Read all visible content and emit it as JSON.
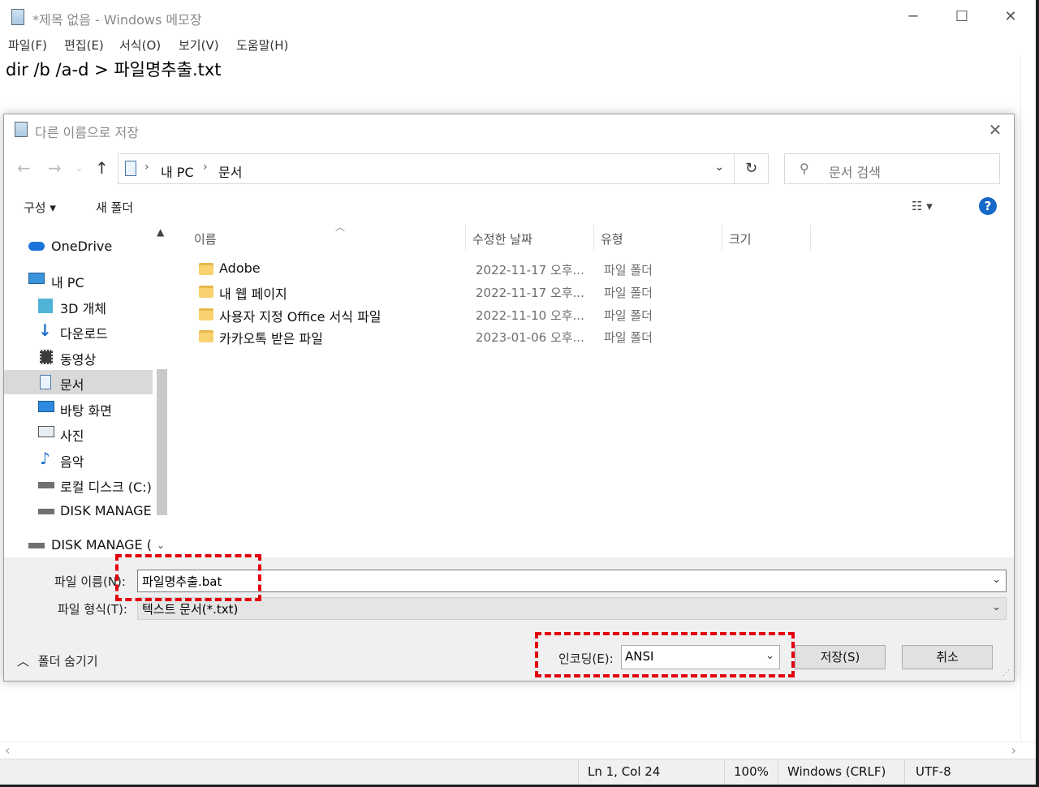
{
  "notepad": {
    "title": "*제목 없음 - Windows 메모장",
    "menu": [
      "파일(F)",
      "편집(E)",
      "서식(O)",
      "보기(V)",
      "도움말(H)"
    ],
    "content": "dir /b /a-d > 파일명추출.txt",
    "status": {
      "position": "Ln 1, Col 24",
      "zoom": "100%",
      "line_ending": "Windows (CRLF)",
      "encoding": "UTF-8"
    }
  },
  "dialog": {
    "title": "다른 이름으로 저장",
    "breadcrumb": [
      "내 PC",
      "문서"
    ],
    "search_placeholder": "문서 검색",
    "organize": "구성 ▾",
    "new_folder": "새 폴더",
    "nav_items": [
      {
        "label": "OneDrive",
        "icon": "cloud-icon"
      },
      {
        "label": "내 PC",
        "icon": "computer-icon"
      },
      {
        "label": "3D 개체",
        "icon": "cube-icon"
      },
      {
        "label": "다운로드",
        "icon": "download-icon"
      },
      {
        "label": "동영상",
        "icon": "video-icon"
      },
      {
        "label": "문서",
        "icon": "document-icon"
      },
      {
        "label": "바탕 화면",
        "icon": "desktop-icon"
      },
      {
        "label": "사진",
        "icon": "picture-icon"
      },
      {
        "label": "음악",
        "icon": "music-icon"
      },
      {
        "label": "로컬 디스크 (C:)",
        "icon": "drive-icon"
      },
      {
        "label": "DISK MANAGE (",
        "icon": "drive-icon"
      },
      {
        "label": "DISK MANAGE (D",
        "icon": "drive-icon"
      }
    ],
    "columns": [
      "이름",
      "수정한 날짜",
      "유형",
      "크기"
    ],
    "files": [
      {
        "name": "Adobe",
        "date": "2022-11-17 오후...",
        "type": "파일 폴더"
      },
      {
        "name": "내 웹 페이지",
        "date": "2022-11-17 오후...",
        "type": "파일 폴더"
      },
      {
        "name": "사용자 지정 Office 서식 파일",
        "date": "2022-11-10 오후...",
        "type": "파일 폴더"
      },
      {
        "name": "카카오톡 받은 파일",
        "date": "2023-01-06 오후...",
        "type": "파일 폴더"
      }
    ],
    "filename_label": "파일 이름(N):",
    "filename_value": "파일명추출.bat",
    "filetype_label": "파일 형식(T):",
    "filetype_value": "텍스트 문서(*.txt)",
    "hide_folders": "폴더 숨기기",
    "encoding_label": "인코딩(E):",
    "encoding_value": "ANSI",
    "save": "저장(S)",
    "cancel": "취소"
  },
  "colors": {
    "highlight": "#e3000f",
    "help_blue": "#1668c7",
    "folder_yellow": "#f7d26f"
  }
}
